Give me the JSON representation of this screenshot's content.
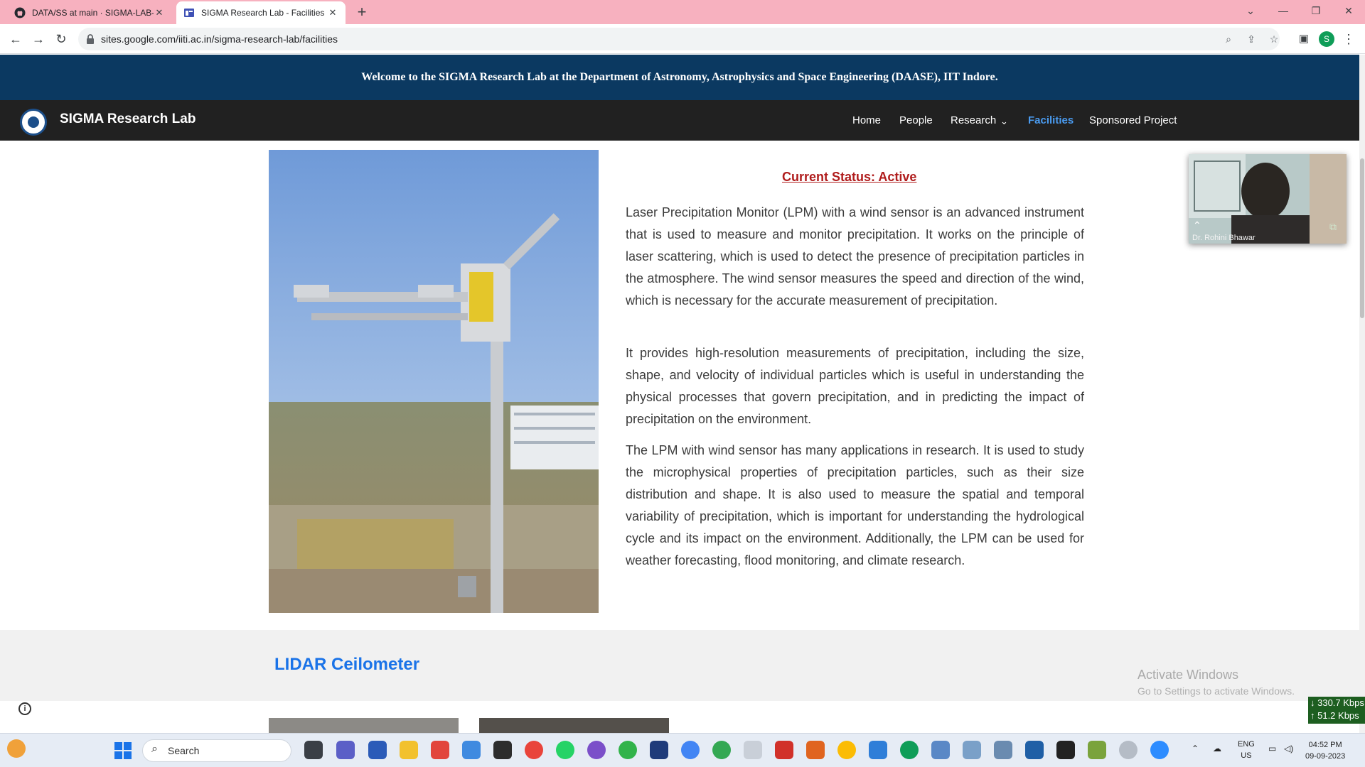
{
  "browser": {
    "tabs": [
      {
        "title": "DATA/SS at main · SIGMA-LAB-IIT",
        "active": false
      },
      {
        "title": "SIGMA Research Lab - Facilities",
        "active": true
      }
    ],
    "new_tab_glyph": "+",
    "url": "sites.google.com/iiti.ac.in/sigma-research-lab/facilities",
    "profile_initial": "S"
  },
  "site": {
    "banner": "Welcome to the SIGMA Research Lab at the Department of Astronomy, Astrophysics and Space Engineering (DAASE), IIT Indore.",
    "title": "SIGMA Research Lab",
    "nav": [
      {
        "label": "Home"
      },
      {
        "label": "People"
      },
      {
        "label": "Research"
      },
      {
        "label": "Facilities",
        "active": true
      },
      {
        "label": "Sponsored Project"
      }
    ]
  },
  "content": {
    "status": "Current Status: Active",
    "paragraphs": [
      "Laser Precipitation Monitor (LPM) with a wind sensor is an advanced instrument that is used to measure and monitor precipitation. It works on the principle of laser scattering, which is used to detect the presence of precipitation particles in the atmosphere. The wind sensor measures the speed and direction of the wind, which is necessary for the accurate measurement of precipitation.",
      "It provides high-resolution measurements of precipitation, including the size, shape, and velocity of individual particles which is useful in understanding the physical processes that govern precipitation, and in predicting the impact of precipitation on the environment.",
      "The LPM with wind sensor has many applications in research. It is used to study the microphysical properties of precipitation particles, such as their size distribution and shape. It is also used to measure the spatial and temporal variability of precipitation, which is important for understanding the hydrological cycle and its impact on the environment. Additionally, the LPM can be used for weather forecasting, flood monitoring, and climate research."
    ],
    "next_section": "LIDAR Ceilometer"
  },
  "overlay": {
    "video_name": "Dr. Rohini Bhawar",
    "activate_title": "Activate Windows",
    "activate_sub": "Go to Settings to activate Windows.",
    "net_down": "↓ 330.7 Kbps",
    "net_up": "↑ 51.2 Kbps"
  },
  "taskbar": {
    "search": "Search",
    "lang1": "ENG",
    "lang2": "US",
    "time": "04:52 PM",
    "date": "09-09-2023"
  },
  "colors": {
    "tabstrip": "#f7b1bf",
    "banner": "#0b3961",
    "nav": "#212121",
    "nav_active": "#4a9bf0",
    "status": "#b01c1c",
    "section_title": "#1a73e8"
  }
}
